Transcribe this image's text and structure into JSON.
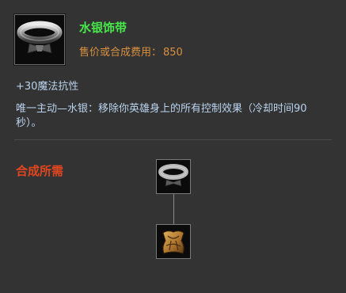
{
  "item": {
    "name": "水银饰带",
    "icon": "quicksilver-sash-icon",
    "price_label": "售价或合成费用：",
    "price_value": "850",
    "stat": "+30魔法抗性",
    "description": "唯一主动—水银：移除你英雄身上的所有控制效果（冷却时间90秒）。"
  },
  "recipe": {
    "title": "合成所需",
    "tree": [
      {
        "icon": "quicksilver-sash-icon"
      },
      {
        "icon": "null-magic-mantle-icon"
      }
    ]
  },
  "colors": {
    "background": "#333333",
    "name": "#46e84a",
    "price": "#d9913f",
    "body_text": "#b9d3ee",
    "recipe_title": "#e0461f"
  }
}
